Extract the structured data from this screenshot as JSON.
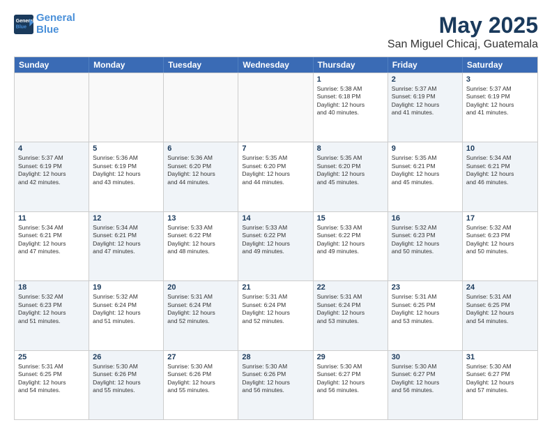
{
  "header": {
    "logo_line1": "General",
    "logo_line2": "Blue",
    "title": "May 2025",
    "subtitle": "San Miguel Chicaj, Guatemala"
  },
  "days_of_week": [
    "Sunday",
    "Monday",
    "Tuesday",
    "Wednesday",
    "Thursday",
    "Friday",
    "Saturday"
  ],
  "weeks": [
    [
      {
        "day": "",
        "text": "",
        "shaded": false,
        "empty": true
      },
      {
        "day": "",
        "text": "",
        "shaded": false,
        "empty": true
      },
      {
        "day": "",
        "text": "",
        "shaded": false,
        "empty": true
      },
      {
        "day": "",
        "text": "",
        "shaded": false,
        "empty": true
      },
      {
        "day": "1",
        "text": "Sunrise: 5:38 AM\nSunset: 6:18 PM\nDaylight: 12 hours\nand 40 minutes.",
        "shaded": false,
        "empty": false
      },
      {
        "day": "2",
        "text": "Sunrise: 5:37 AM\nSunset: 6:19 PM\nDaylight: 12 hours\nand 41 minutes.",
        "shaded": true,
        "empty": false
      },
      {
        "day": "3",
        "text": "Sunrise: 5:37 AM\nSunset: 6:19 PM\nDaylight: 12 hours\nand 41 minutes.",
        "shaded": false,
        "empty": false
      }
    ],
    [
      {
        "day": "4",
        "text": "Sunrise: 5:37 AM\nSunset: 6:19 PM\nDaylight: 12 hours\nand 42 minutes.",
        "shaded": true,
        "empty": false
      },
      {
        "day": "5",
        "text": "Sunrise: 5:36 AM\nSunset: 6:19 PM\nDaylight: 12 hours\nand 43 minutes.",
        "shaded": false,
        "empty": false
      },
      {
        "day": "6",
        "text": "Sunrise: 5:36 AM\nSunset: 6:20 PM\nDaylight: 12 hours\nand 44 minutes.",
        "shaded": true,
        "empty": false
      },
      {
        "day": "7",
        "text": "Sunrise: 5:35 AM\nSunset: 6:20 PM\nDaylight: 12 hours\nand 44 minutes.",
        "shaded": false,
        "empty": false
      },
      {
        "day": "8",
        "text": "Sunrise: 5:35 AM\nSunset: 6:20 PM\nDaylight: 12 hours\nand 45 minutes.",
        "shaded": true,
        "empty": false
      },
      {
        "day": "9",
        "text": "Sunrise: 5:35 AM\nSunset: 6:21 PM\nDaylight: 12 hours\nand 45 minutes.",
        "shaded": false,
        "empty": false
      },
      {
        "day": "10",
        "text": "Sunrise: 5:34 AM\nSunset: 6:21 PM\nDaylight: 12 hours\nand 46 minutes.",
        "shaded": true,
        "empty": false
      }
    ],
    [
      {
        "day": "11",
        "text": "Sunrise: 5:34 AM\nSunset: 6:21 PM\nDaylight: 12 hours\nand 47 minutes.",
        "shaded": false,
        "empty": false
      },
      {
        "day": "12",
        "text": "Sunrise: 5:34 AM\nSunset: 6:21 PM\nDaylight: 12 hours\nand 47 minutes.",
        "shaded": true,
        "empty": false
      },
      {
        "day": "13",
        "text": "Sunrise: 5:33 AM\nSunset: 6:22 PM\nDaylight: 12 hours\nand 48 minutes.",
        "shaded": false,
        "empty": false
      },
      {
        "day": "14",
        "text": "Sunrise: 5:33 AM\nSunset: 6:22 PM\nDaylight: 12 hours\nand 49 minutes.",
        "shaded": true,
        "empty": false
      },
      {
        "day": "15",
        "text": "Sunrise: 5:33 AM\nSunset: 6:22 PM\nDaylight: 12 hours\nand 49 minutes.",
        "shaded": false,
        "empty": false
      },
      {
        "day": "16",
        "text": "Sunrise: 5:32 AM\nSunset: 6:23 PM\nDaylight: 12 hours\nand 50 minutes.",
        "shaded": true,
        "empty": false
      },
      {
        "day": "17",
        "text": "Sunrise: 5:32 AM\nSunset: 6:23 PM\nDaylight: 12 hours\nand 50 minutes.",
        "shaded": false,
        "empty": false
      }
    ],
    [
      {
        "day": "18",
        "text": "Sunrise: 5:32 AM\nSunset: 6:23 PM\nDaylight: 12 hours\nand 51 minutes.",
        "shaded": true,
        "empty": false
      },
      {
        "day": "19",
        "text": "Sunrise: 5:32 AM\nSunset: 6:24 PM\nDaylight: 12 hours\nand 51 minutes.",
        "shaded": false,
        "empty": false
      },
      {
        "day": "20",
        "text": "Sunrise: 5:31 AM\nSunset: 6:24 PM\nDaylight: 12 hours\nand 52 minutes.",
        "shaded": true,
        "empty": false
      },
      {
        "day": "21",
        "text": "Sunrise: 5:31 AM\nSunset: 6:24 PM\nDaylight: 12 hours\nand 52 minutes.",
        "shaded": false,
        "empty": false
      },
      {
        "day": "22",
        "text": "Sunrise: 5:31 AM\nSunset: 6:24 PM\nDaylight: 12 hours\nand 53 minutes.",
        "shaded": true,
        "empty": false
      },
      {
        "day": "23",
        "text": "Sunrise: 5:31 AM\nSunset: 6:25 PM\nDaylight: 12 hours\nand 53 minutes.",
        "shaded": false,
        "empty": false
      },
      {
        "day": "24",
        "text": "Sunrise: 5:31 AM\nSunset: 6:25 PM\nDaylight: 12 hours\nand 54 minutes.",
        "shaded": true,
        "empty": false
      }
    ],
    [
      {
        "day": "25",
        "text": "Sunrise: 5:31 AM\nSunset: 6:25 PM\nDaylight: 12 hours\nand 54 minutes.",
        "shaded": false,
        "empty": false
      },
      {
        "day": "26",
        "text": "Sunrise: 5:30 AM\nSunset: 6:26 PM\nDaylight: 12 hours\nand 55 minutes.",
        "shaded": true,
        "empty": false
      },
      {
        "day": "27",
        "text": "Sunrise: 5:30 AM\nSunset: 6:26 PM\nDaylight: 12 hours\nand 55 minutes.",
        "shaded": false,
        "empty": false
      },
      {
        "day": "28",
        "text": "Sunrise: 5:30 AM\nSunset: 6:26 PM\nDaylight: 12 hours\nand 56 minutes.",
        "shaded": true,
        "empty": false
      },
      {
        "day": "29",
        "text": "Sunrise: 5:30 AM\nSunset: 6:27 PM\nDaylight: 12 hours\nand 56 minutes.",
        "shaded": false,
        "empty": false
      },
      {
        "day": "30",
        "text": "Sunrise: 5:30 AM\nSunset: 6:27 PM\nDaylight: 12 hours\nand 56 minutes.",
        "shaded": true,
        "empty": false
      },
      {
        "day": "31",
        "text": "Sunrise: 5:30 AM\nSunset: 6:27 PM\nDaylight: 12 hours\nand 57 minutes.",
        "shaded": false,
        "empty": false
      }
    ]
  ]
}
